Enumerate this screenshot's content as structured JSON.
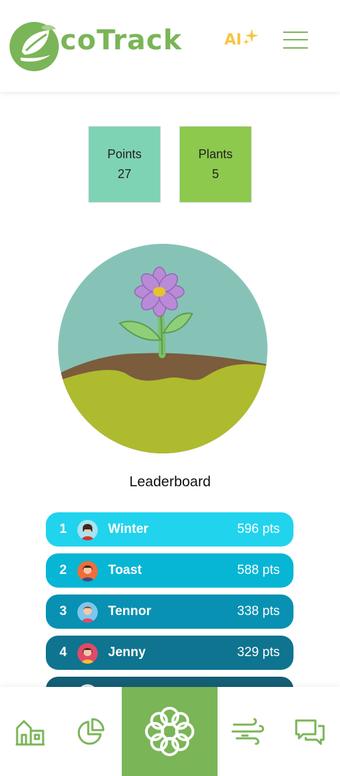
{
  "header": {
    "app_name": "coTrack",
    "ai_label": "AI",
    "logo_icon": "leaf-e-logo",
    "ai_icon": "sparkles-icon",
    "menu_icon": "hamburger-menu-icon"
  },
  "stats": {
    "points": {
      "label": "Points",
      "value": "27"
    },
    "plants": {
      "label": "Plants",
      "value": "5"
    }
  },
  "plant_illustration": {
    "icon": "flower-plant-illustration"
  },
  "leaderboard": {
    "title": "Leaderboard",
    "rows": [
      {
        "rank": "1",
        "name": "Winter",
        "points": "596 pts",
        "color": "#22d3ee"
      },
      {
        "rank": "2",
        "name": "Toast",
        "points": "588 pts",
        "color": "#06b6d4"
      },
      {
        "rank": "3",
        "name": "Tennor",
        "points": "338 pts",
        "color": "#0891b2"
      },
      {
        "rank": "4",
        "name": "Jenny",
        "points": "329 pts",
        "color": "#0e7490"
      },
      {
        "rank": "",
        "name": "",
        "points": "",
        "color": "#155e75"
      }
    ]
  },
  "bottom_nav": {
    "items": [
      "home-icon",
      "pie-chart-icon",
      "flower-icon",
      "wind-icon",
      "chat-bubbles-icon"
    ],
    "active": "flower-icon"
  },
  "colors": {
    "brand_green": "#7ab557",
    "accent_yellow": "#f6c544",
    "points_box": "#7fd3b5",
    "plants_box": "#8cc94d"
  }
}
